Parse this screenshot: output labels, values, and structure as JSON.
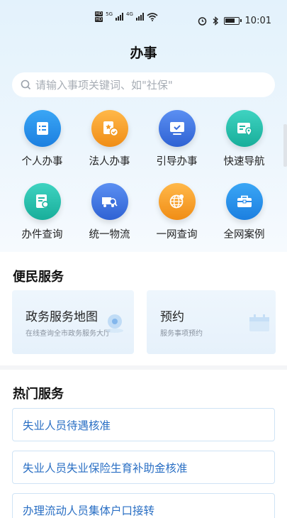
{
  "status_bar": {
    "hd1": "HD",
    "hd2": "HD",
    "sig1": "5G",
    "sig2": "4G",
    "time": "10:01",
    "battery_level": 0.75
  },
  "page_title": "办事",
  "search": {
    "placeholder": "请输入事项关键词、如\"社保\""
  },
  "quick_menu": [
    {
      "label": "个人办事",
      "icon": "list-doc-icon",
      "color": "blue"
    },
    {
      "label": "法人办事",
      "icon": "badge-check-icon",
      "color": "orange"
    },
    {
      "label": "引导办事",
      "icon": "monitor-check-icon",
      "color": "navy"
    },
    {
      "label": "快速导航",
      "icon": "map-pin-card-icon",
      "color": "teal"
    },
    {
      "label": "办件查询",
      "icon": "doc-search-icon",
      "color": "teal"
    },
    {
      "label": "统一物流",
      "icon": "truck-search-icon",
      "color": "navy"
    },
    {
      "label": "一网查询",
      "icon": "globe-pin-icon",
      "color": "orange"
    },
    {
      "label": "全网案例",
      "icon": "briefcase-icon",
      "color": "blue"
    }
  ],
  "convenience": {
    "title": "便民服务",
    "cards": [
      {
        "title": "政务服务地图",
        "subtitle": "在线查询全市政务服务大厅",
        "icon": "map-marker-icon"
      },
      {
        "title": "预约",
        "subtitle": "服务事项预约",
        "icon": "calendar-icon"
      }
    ]
  },
  "hot": {
    "title": "热门服务",
    "items": [
      "失业人员待遇核准",
      "失业人员失业保险生育补助金核准",
      "办理流动人员集体户口接转"
    ]
  }
}
